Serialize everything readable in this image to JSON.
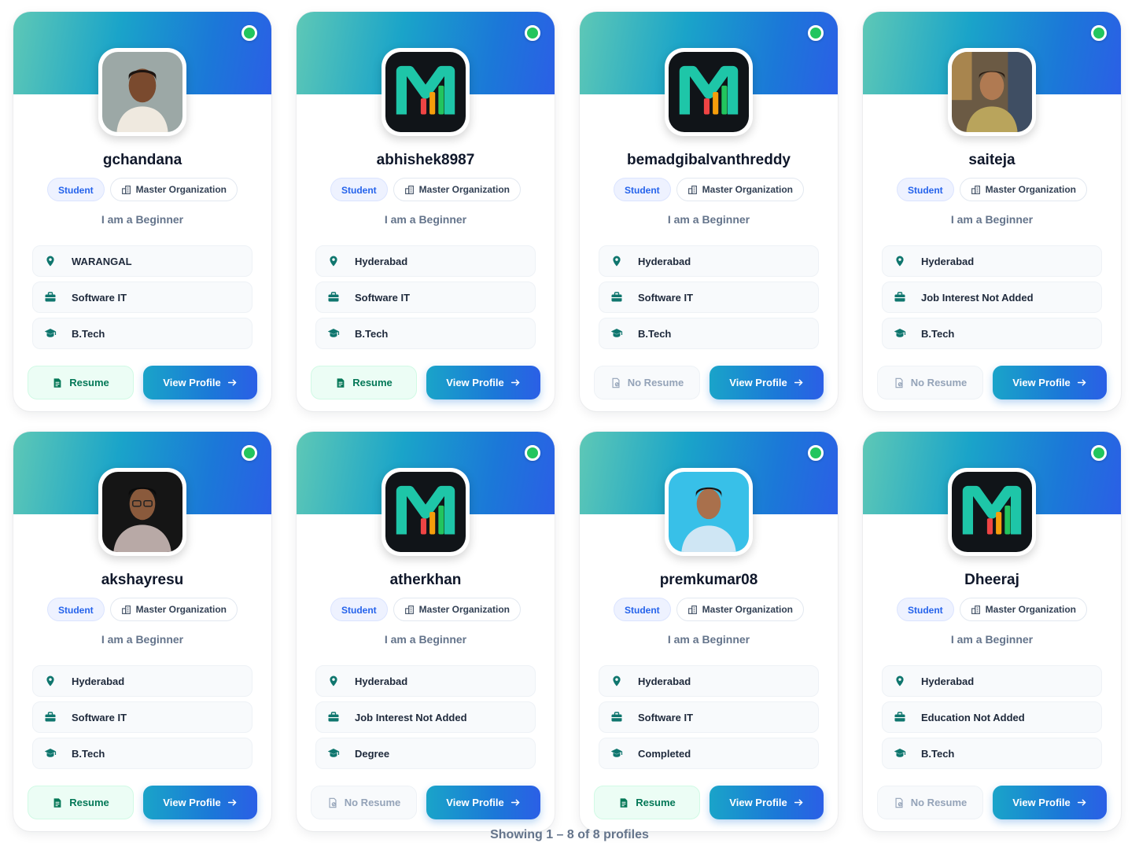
{
  "profiles": [
    {
      "name": "gchandana",
      "role": "Student",
      "org": "Master Organization",
      "level": "I am a Beginner",
      "location": "WARANGAL",
      "interest": "Software IT",
      "education": "B.Tech",
      "resume": "Resume",
      "has_resume": true,
      "view": "View Profile",
      "avatar": "photo-woman"
    },
    {
      "name": "abhishek8987",
      "role": "Student",
      "org": "Master Organization",
      "level": "I am a Beginner",
      "location": "Hyderabad",
      "interest": "Software IT",
      "education": "B.Tech",
      "resume": "Resume",
      "has_resume": true,
      "view": "View Profile",
      "avatar": "logo"
    },
    {
      "name": "bemadgibalvanthreddy",
      "role": "Student",
      "org": "Master Organization",
      "level": "I am a Beginner",
      "location": "Hyderabad",
      "interest": "Software IT",
      "education": "B.Tech",
      "resume": "No Resume",
      "has_resume": false,
      "view": "View Profile",
      "avatar": "logo"
    },
    {
      "name": "saiteja",
      "role": "Student",
      "org": "Master Organization",
      "level": "I am a Beginner",
      "location": "Hyderabad",
      "interest": "Job Interest Not Added",
      "education": "B.Tech",
      "resume": "No Resume",
      "has_resume": false,
      "view": "View Profile",
      "avatar": "photo-man-outdoor"
    },
    {
      "name": "akshayresu",
      "role": "Student",
      "org": "Master Organization",
      "level": "I am a Beginner",
      "location": "Hyderabad",
      "interest": "Software IT",
      "education": "B.Tech",
      "resume": "Resume",
      "has_resume": true,
      "view": "View Profile",
      "avatar": "photo-man-dark"
    },
    {
      "name": "atherkhan",
      "role": "Student",
      "org": "Master Organization",
      "level": "I am a Beginner",
      "location": "Hyderabad",
      "interest": "Job Interest Not Added",
      "education": "Degree",
      "resume": "No Resume",
      "has_resume": false,
      "view": "View Profile",
      "avatar": "logo"
    },
    {
      "name": "premkumar08",
      "role": "Student",
      "org": "Master Organization",
      "level": "I am a Beginner",
      "location": "Hyderabad",
      "interest": "Software IT",
      "education": "Completed",
      "resume": "Resume",
      "has_resume": true,
      "view": "View Profile",
      "avatar": "photo-man-blue"
    },
    {
      "name": "Dheeraj",
      "role": "Student",
      "org": "Master Organization",
      "level": "I am a Beginner",
      "location": "Hyderabad",
      "interest": "Education Not Added",
      "education": "B.Tech",
      "resume": "No Resume",
      "has_resume": false,
      "view": "View Profile",
      "avatar": "logo"
    }
  ],
  "footer": {
    "text": "Showing 1 – 8 of 8 profiles"
  },
  "colors": {
    "accent": "#1b78d8",
    "online": "#22c55e",
    "student": "#2563eb",
    "resume_green": "#047857",
    "icon_green": "#0f766e"
  }
}
